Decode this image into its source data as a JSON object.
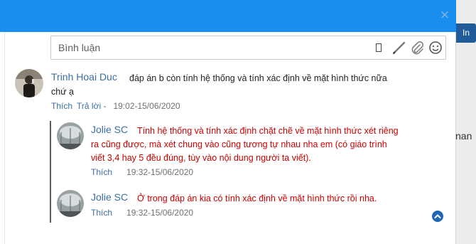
{
  "background": {
    "button_label": "In",
    "side_text": "nan"
  },
  "modal": {
    "close_glyph": "×"
  },
  "comment_box": {
    "placeholder": "Bình luận"
  },
  "comments": [
    {
      "author": "Trinh Hoai Duc",
      "text_line1": "đáp án b còn tính hệ thống và tính xác định về mặt hình thức nữa",
      "text_line2": "chứ ạ",
      "like_label": "Thích",
      "reply_label": "Trả lời -",
      "timestamp": "19:02-15/06/2020",
      "text_color": "#222222"
    }
  ],
  "replies": [
    {
      "author": "Jolie SC",
      "text_line1": "Tính hệ thống và tính xác định chặt chẽ về mặt hình thức xét riêng",
      "text_line2": "ra cũng được, mà xét chung vào cũng tương tự nhau nha em (có giáo trình",
      "text_line3": "viết 3,4 hay 5 đều đúng, tùy vào nội dung người ta viết).",
      "like_label": "Thích",
      "timestamp": "19:32-15/06/2020",
      "text_color": "#cc0000"
    },
    {
      "author": "Jolie SC",
      "text_line1": "Ở trong đáp án kia có tính xác định về mặt hình thức rồi nha.",
      "like_label": "Thích",
      "timestamp": "19:32-15/06/2020",
      "text_color": "#cc0000"
    }
  ],
  "colors": {
    "header": "#1a8ef0",
    "link": "#3b6ea5",
    "reply_text": "#cc0000"
  }
}
